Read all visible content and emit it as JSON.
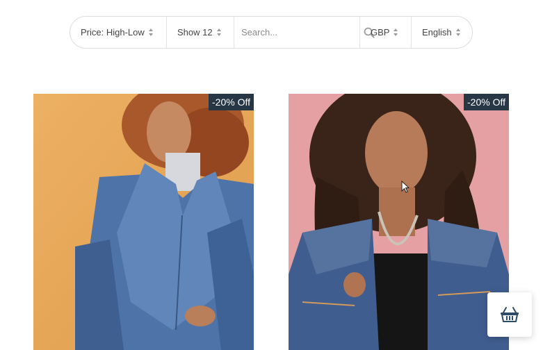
{
  "filters": {
    "sort_label": "Price: High-Low",
    "show_label": "Show 12",
    "search_placeholder": "Search...",
    "currency_label": "GBP",
    "language_label": "English"
  },
  "products": [
    {
      "badge": "-20% Off",
      "background_color": "#e8a95a",
      "garment_color": "#4d73a8"
    },
    {
      "badge": "-20% Off",
      "background_color": "#e5a2a2",
      "garment_color": "#3f5d8f"
    }
  ],
  "icons": {
    "search": "magnifier-icon",
    "cart": "basket-icon",
    "sort": "up-down-arrows-icon"
  }
}
